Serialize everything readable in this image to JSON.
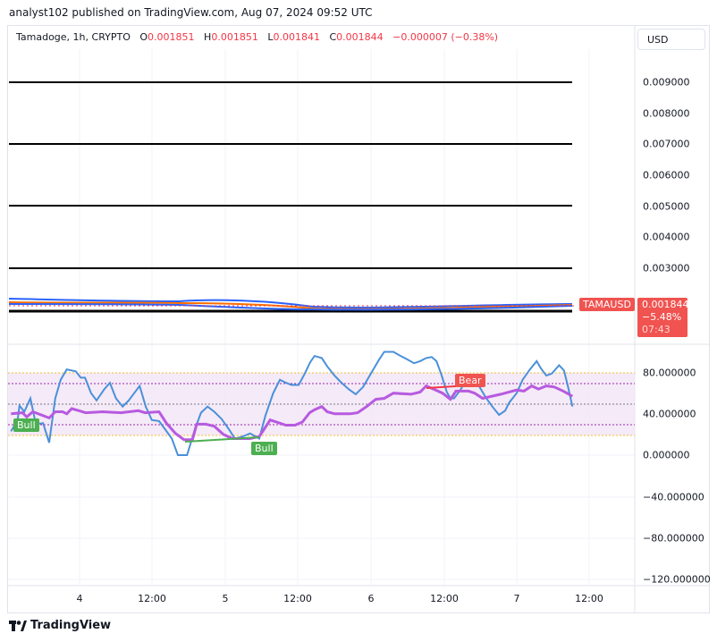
{
  "header": {
    "published": "analyst102 published on TradingView.com, Aug 07, 2024 09:52 UTC"
  },
  "legend": {
    "symbol": "Tamadoge, 1h, CRYPTO",
    "o_label": "O",
    "o": "0.001851",
    "h_label": "H",
    "h": "0.001851",
    "l_label": "L",
    "l": "0.001841",
    "c_label": "C",
    "c": "0.001844",
    "change": "−0.000007 (−0.38%)"
  },
  "currency_button": "USD",
  "price_axis": [
    "0.009000",
    "0.008000",
    "0.007000",
    "0.006000",
    "0.005000",
    "0.004000",
    "0.003000"
  ],
  "price_tag": {
    "symbol": "TAMAUSD",
    "price": "0.001844",
    "change": "−5.48%",
    "countdown": "07:43"
  },
  "osc_axis": [
    "80.000000",
    "40.000000",
    "0.000000",
    "−40.000000",
    "−80.000000",
    "−120.000000"
  ],
  "time_axis": [
    "4",
    "12:00",
    "5",
    "12:00",
    "6",
    "12:00",
    "7",
    "12:00"
  ],
  "signals": {
    "bull1": "Bull",
    "bull2": "Bull",
    "bear": "Bear"
  },
  "colors": {
    "up": "#089981",
    "down": "#f23645",
    "stoch": "#4a90d9",
    "rsi": "#b75ae0"
  },
  "osc_series": {
    "stoch_k": [
      [
        0.7,
        23
      ],
      [
        1.8,
        34
      ],
      [
        2.1,
        48
      ],
      [
        2.9,
        42
      ],
      [
        3.9,
        55
      ],
      [
        4.8,
        30
      ],
      [
        6.0,
        31
      ],
      [
        7.0,
        12
      ],
      [
        8.0,
        55
      ],
      [
        8.9,
        73
      ],
      [
        9.9,
        83
      ],
      [
        11.4,
        81
      ],
      [
        12.2,
        75
      ],
      [
        12.9,
        75
      ],
      [
        13.9,
        60
      ],
      [
        14.8,
        53
      ],
      [
        16.1,
        64
      ],
      [
        17.0,
        70
      ],
      [
        18.0,
        55
      ],
      [
        19.1,
        47
      ],
      [
        20.1,
        53
      ],
      [
        21.0,
        60
      ],
      [
        21.9,
        67
      ],
      [
        22.9,
        47
      ],
      [
        23.9,
        34
      ],
      [
        25.1,
        33
      ],
      [
        26.1,
        25
      ],
      [
        27.2,
        16
      ],
      [
        28.2,
        0
      ],
      [
        29.7,
        0
      ],
      [
        31.0,
        25
      ],
      [
        32.0,
        41
      ],
      [
        33.1,
        47
      ],
      [
        34.2,
        42
      ],
      [
        35.4,
        35
      ],
      [
        36.6,
        25
      ],
      [
        37.6,
        16
      ],
      [
        38.9,
        18
      ],
      [
        40.1,
        21
      ],
      [
        41.6,
        16
      ],
      [
        42.6,
        38
      ],
      [
        43.9,
        60
      ],
      [
        45.0,
        73
      ],
      [
        46.0,
        70
      ],
      [
        46.9,
        68
      ],
      [
        48.1,
        68
      ],
      [
        49.1,
        79
      ],
      [
        50.0,
        90
      ],
      [
        50.7,
        96
      ],
      [
        51.9,
        94
      ],
      [
        52.8,
        86
      ],
      [
        54.0,
        77
      ],
      [
        55.0,
        71
      ],
      [
        56.3,
        64
      ],
      [
        57.5,
        59
      ],
      [
        58.7,
        66
      ],
      [
        60.0,
        79
      ],
      [
        61.3,
        92
      ],
      [
        62.2,
        100
      ],
      [
        63.7,
        100
      ],
      [
        64.9,
        96
      ],
      [
        65.9,
        93
      ],
      [
        67.1,
        89
      ],
      [
        68.1,
        91
      ],
      [
        69.1,
        94
      ],
      [
        70.0,
        95
      ],
      [
        70.8,
        91
      ],
      [
        71.6,
        78
      ],
      [
        72.5,
        61
      ],
      [
        73.1,
        55
      ],
      [
        73.7,
        55
      ],
      [
        74.6,
        62
      ],
      [
        75.6,
        71
      ],
      [
        76.7,
        68
      ],
      [
        77.7,
        68
      ],
      [
        78.9,
        56
      ],
      [
        80.0,
        47
      ],
      [
        81.1,
        39
      ],
      [
        82.1,
        43
      ],
      [
        82.8,
        51
      ],
      [
        84.0,
        60
      ],
      [
        85.0,
        73
      ],
      [
        86.2,
        83
      ],
      [
        87.3,
        91
      ],
      [
        88.0,
        84
      ],
      [
        88.9,
        77
      ],
      [
        89.8,
        79
      ],
      [
        91.0,
        87
      ],
      [
        91.8,
        82
      ],
      [
        92.4,
        68
      ],
      [
        93.2,
        47
      ]
    ],
    "rsi": [
      [
        0.7,
        40
      ],
      [
        2.6,
        41
      ],
      [
        3.3,
        37
      ],
      [
        4.3,
        42
      ],
      [
        7.0,
        36
      ],
      [
        8.0,
        42
      ],
      [
        9.2,
        42
      ],
      [
        9.9,
        40
      ],
      [
        10.7,
        45
      ],
      [
        11.9,
        43
      ],
      [
        13.0,
        41
      ],
      [
        15.8,
        42
      ],
      [
        18.8,
        41
      ],
      [
        21.7,
        43
      ],
      [
        22.8,
        41
      ],
      [
        25.1,
        42
      ],
      [
        26.3,
        31
      ],
      [
        27.8,
        21
      ],
      [
        29.2,
        15
      ],
      [
        30.6,
        15
      ],
      [
        31.3,
        30
      ],
      [
        32.8,
        30
      ],
      [
        34.2,
        28
      ],
      [
        35.7,
        20
      ],
      [
        37.2,
        16
      ],
      [
        40.1,
        16
      ],
      [
        41.6,
        18
      ],
      [
        42.5,
        26
      ],
      [
        43.4,
        34
      ],
      [
        46.0,
        29
      ],
      [
        47.5,
        29
      ],
      [
        48.7,
        32
      ],
      [
        49.9,
        41
      ],
      [
        50.7,
        44
      ],
      [
        51.9,
        47
      ],
      [
        52.8,
        42
      ],
      [
        54.0,
        40
      ],
      [
        56.6,
        40
      ],
      [
        57.8,
        41
      ],
      [
        59.3,
        47
      ],
      [
        60.8,
        54
      ],
      [
        62.2,
        55
      ],
      [
        63.7,
        60
      ],
      [
        66.6,
        59
      ],
      [
        68.1,
        61
      ],
      [
        69.1,
        67
      ],
      [
        70.3,
        64
      ],
      [
        71.8,
        60
      ],
      [
        73.1,
        54
      ],
      [
        74.0,
        62
      ],
      [
        76.1,
        62
      ],
      [
        77.1,
        60
      ],
      [
        78.4,
        55
      ],
      [
        81.4,
        59
      ],
      [
        84.0,
        63
      ],
      [
        85.2,
        62
      ],
      [
        86.5,
        67
      ],
      [
        87.6,
        64
      ],
      [
        88.9,
        67
      ],
      [
        90.2,
        66
      ],
      [
        91.7,
        62
      ],
      [
        93.2,
        57
      ]
    ]
  },
  "footer": {
    "brand": "TradingView"
  }
}
